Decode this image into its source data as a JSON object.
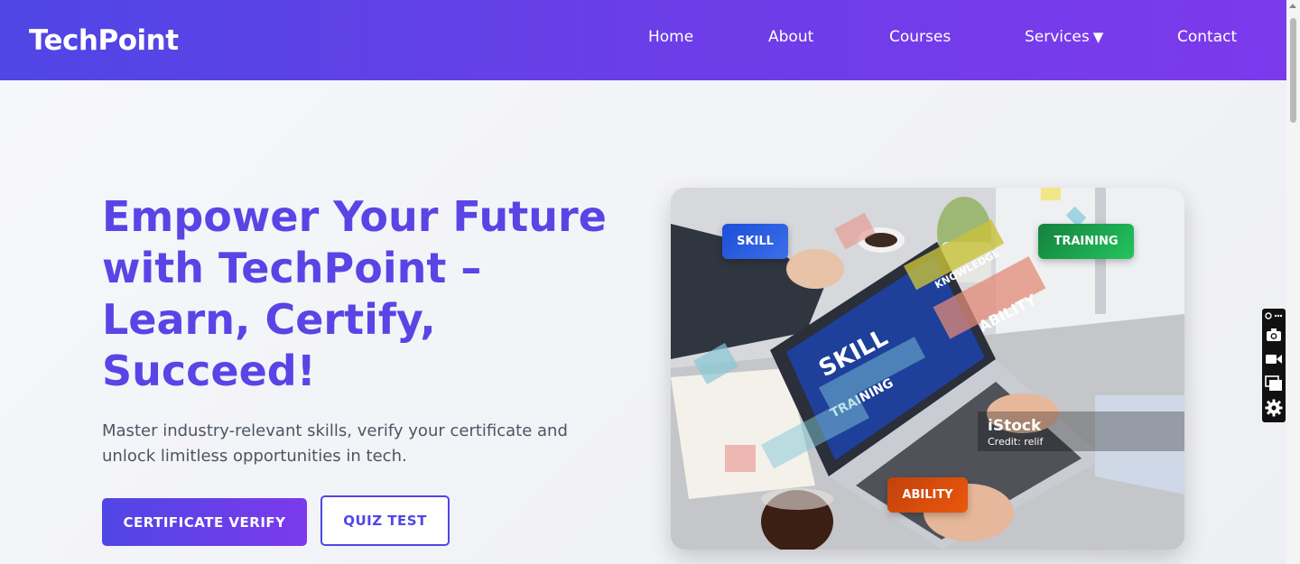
{
  "header": {
    "logo": "TechPoint",
    "nav": [
      {
        "label": "Home"
      },
      {
        "label": "About"
      },
      {
        "label": "Courses"
      },
      {
        "label": "Services",
        "caret": "▼"
      },
      {
        "label": "Contact"
      }
    ]
  },
  "hero": {
    "title": "Empower Your Future with TechPoint – Learn, Certify, Succeed!",
    "subtitle": "Master industry-relevant skills, verify your certificate and unlock limitless opportunities in tech.",
    "primary_button": "CERTIFICATE VERIFY",
    "secondary_button": "QUIZ TEST"
  },
  "image_card": {
    "badges": {
      "skill": "SKILL",
      "training": "TRAINING",
      "ability": "ABILITY"
    },
    "screen_words": [
      "SKILL",
      "TRAINING",
      "KNOWLEDGE",
      "ABILITY"
    ],
    "watermark": "iStock",
    "watermark_credit": "Credit: relif"
  },
  "side_widget": {
    "icons": [
      "link-icon",
      "camera-icon",
      "video-icon",
      "window-icon",
      "gear-icon"
    ]
  },
  "colors": {
    "brand_gradient_start": "#4f46e5",
    "brand_gradient_end": "#7c3aed",
    "title_color": "#5b44e6",
    "skill_badge": "#1d4ed8",
    "training_badge": "#16a34a",
    "ability_badge": "#ea580c"
  }
}
